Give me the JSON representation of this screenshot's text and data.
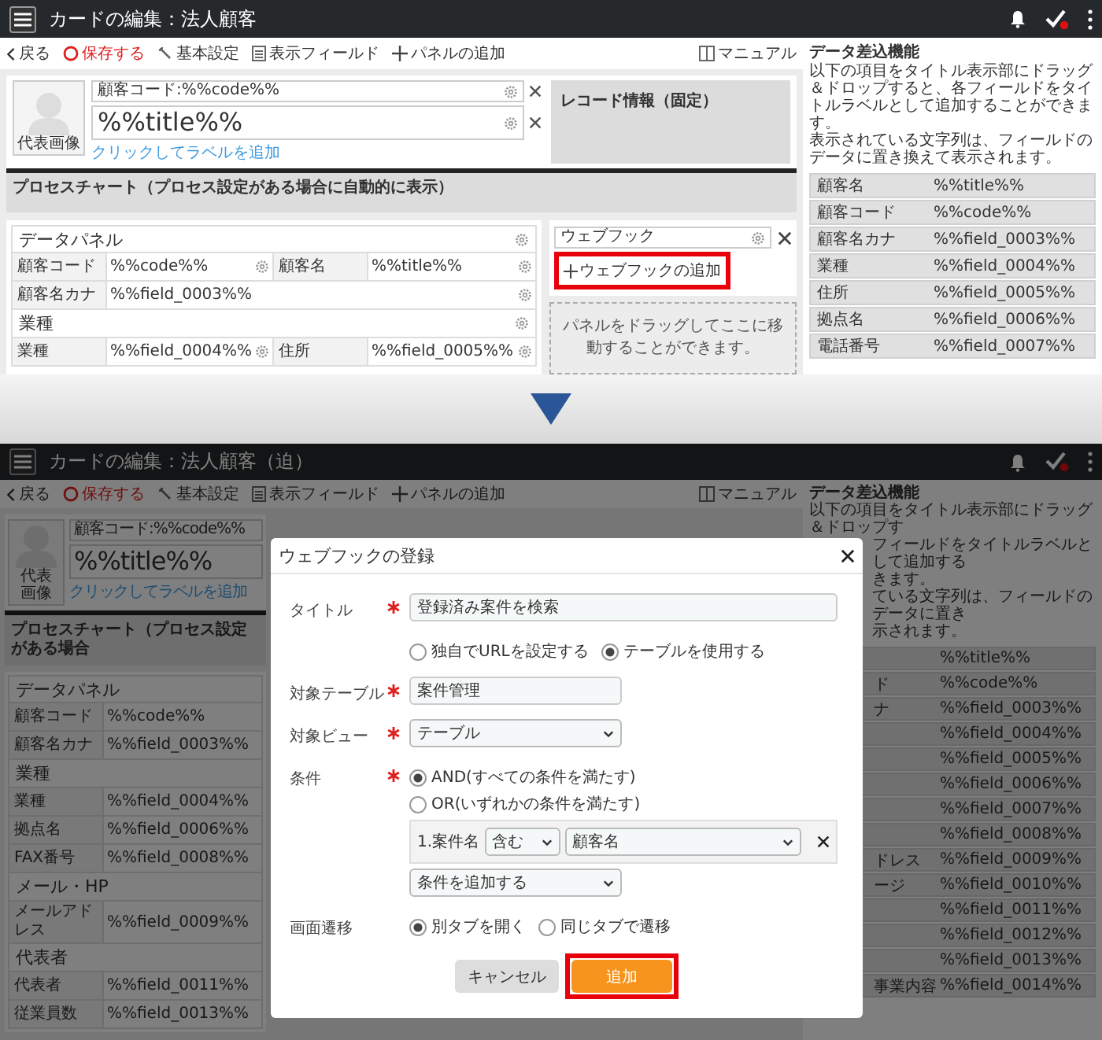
{
  "top_screen": {
    "header": {
      "title": "カードの編集：法人顧客"
    },
    "toolbar": [
      {
        "kind": "back",
        "label": "戻る"
      },
      {
        "kind": "save",
        "label": "保存する"
      },
      {
        "kind": "settings",
        "label": "基本設定"
      },
      {
        "kind": "fields",
        "label": "表示フィールド"
      },
      {
        "kind": "add",
        "label": "パネルの追加"
      }
    ],
    "manual": "マニュアル",
    "card": {
      "avatar_label": "代表画像",
      "code_label": "顧客コード:%%code%%",
      "title_label": "%%title%%",
      "add_label_link": "クリックしてラベルを追加"
    },
    "record_info": "レコード情報（固定）",
    "process_chart": "プロセスチャート（プロセス設定がある場合に自動的に表示）",
    "data_panel": {
      "title": "データパネル",
      "rows": [
        {
          "kind": "fields",
          "cells": [
            {
              "label": "顧客コード",
              "value": "%%code%%"
            },
            {
              "label": "顧客名",
              "value": "%%title%%"
            }
          ]
        },
        {
          "kind": "fields",
          "cells": [
            {
              "label": "顧客名カナ",
              "value": "%%field_0003%%"
            }
          ]
        },
        {
          "kind": "section",
          "label": "業種"
        },
        {
          "kind": "fields",
          "cells": [
            {
              "label": "業種",
              "value": "%%field_0004%%"
            },
            {
              "label": "住所",
              "value": "%%field_0005%%"
            }
          ]
        }
      ]
    },
    "webhook_panel": {
      "field": "ウェブフック",
      "add_link": {
        "label": "ウェブフックの追加",
        "highlighted": true
      }
    },
    "drop_zone": "パネルをドラッグしてここに移動することができます。",
    "side_panel": {
      "title": "データ差込機能",
      "description": [
        "以下の項目をタイトル表示部にドラッグ＆ドロップすると、各フィールドをタイトルラベルとして追加することができます。",
        "表示されている文字列は、フィールドのデータに置き換えて表示されます。"
      ],
      "rows": [
        {
          "label": "顧客名",
          "value": "%%title%%"
        },
        {
          "label": "顧客コード",
          "value": "%%code%%"
        },
        {
          "label": "顧客名カナ",
          "value": "%%field_0003%%"
        },
        {
          "label": "業種",
          "value": "%%field_0004%%"
        },
        {
          "label": "住所",
          "value": "%%field_0005%%"
        },
        {
          "label": "拠点名",
          "value": "%%field_0006%%"
        },
        {
          "label": "電話番号",
          "value": "%%field_0007%%"
        }
      ]
    }
  },
  "bottom_screen": {
    "header": {
      "title": "カードの編集：法人顧客（迫）"
    },
    "toolbar": [
      {
        "kind": "back",
        "label": "戻る"
      },
      {
        "kind": "save",
        "label": "保存する"
      },
      {
        "kind": "settings",
        "label": "基本設定"
      },
      {
        "kind": "fields",
        "label": "表示フィールド"
      },
      {
        "kind": "add",
        "label": "パネルの追加"
      }
    ],
    "manual": "マニュアル",
    "card": {
      "avatar_label": "代表画像",
      "code_label": "顧客コード:%%code%%",
      "title_label": "%%title%%",
      "add_label_link": "クリックしてラベルを追加"
    },
    "process_chart": "プロセスチャート（プロセス設定がある場合",
    "data_panel": {
      "title": "データパネル",
      "rows": [
        {
          "kind": "fields",
          "cells": [
            {
              "label": "顧客コード",
              "value": "%%code%%"
            }
          ]
        },
        {
          "kind": "fields",
          "cells": [
            {
              "label": "顧客名カナ",
              "value": "%%field_0003%%"
            }
          ]
        },
        {
          "kind": "section",
          "label": "業種"
        },
        {
          "kind": "fields",
          "cells": [
            {
              "label": "業種",
              "value": "%%field_0004%%"
            }
          ]
        },
        {
          "kind": "fields",
          "cells": [
            {
              "label": "拠点名",
              "value": "%%field_0006%%"
            }
          ]
        },
        {
          "kind": "fields",
          "cells": [
            {
              "label": "FAX番号",
              "value": "%%field_0008%%"
            }
          ]
        },
        {
          "kind": "section",
          "label": "メール・HP"
        },
        {
          "kind": "fields",
          "cells": [
            {
              "label": "メールアドレス",
              "value": "%%field_0009%%"
            }
          ]
        },
        {
          "kind": "section",
          "label": "代表者"
        },
        {
          "kind": "fields",
          "cells": [
            {
              "label": "代表者",
              "value": "%%field_0011%%"
            }
          ]
        },
        {
          "kind": "fields",
          "cells": [
            {
              "label": "従業員数",
              "value": "%%field_0013%%"
            }
          ]
        }
      ]
    },
    "side_panel": {
      "title": "データ差込機能",
      "description": [
        "以下の項目をタイトル表示部にドラッグ＆ドロップす",
        "フィールドをタイトルラベルとして追加する",
        "きます。",
        "ている文字列は、フィールドのデータに置き",
        "示されます。"
      ],
      "rows": [
        {
          "value": "%%title%%"
        },
        {
          "label": "ド",
          "value": "%%code%%"
        },
        {
          "label": "ナ",
          "value": "%%field_0003%%"
        },
        {
          "value": "%%field_0004%%"
        },
        {
          "value": "%%field_0005%%"
        },
        {
          "value": "%%field_0006%%"
        },
        {
          "value": "%%field_0007%%"
        },
        {
          "value": "%%field_0008%%"
        },
        {
          "label": "ドレス",
          "value": "%%field_0009%%"
        },
        {
          "label": "ージ",
          "value": "%%field_0010%%"
        },
        {
          "value": "%%field_0011%%"
        },
        {
          "value": "%%field_0012%%"
        },
        {
          "value": "%%field_0013%%"
        },
        {
          "label": "事業内容",
          "value": "%%field_0014%%"
        }
      ]
    },
    "dialog": {
      "title": "ウェブフックの登録",
      "fields": [
        {
          "kind": "text",
          "label": "タイトル",
          "required": true,
          "value": "登録済み案件を検索"
        },
        {
          "kind": "radios",
          "options": [
            {
              "label": "独自でURLを設定する",
              "selected": false
            },
            {
              "label": "テーブルを使用する",
              "selected": true
            }
          ]
        },
        {
          "kind": "text",
          "label": "対象テーブル",
          "required": true,
          "value": "案件管理"
        },
        {
          "kind": "select",
          "label": "対象ビュー",
          "required": true,
          "value": "テーブル"
        },
        {
          "kind": "condition",
          "label": "条件",
          "required": true,
          "options": [
            {
              "label": "AND(すべての条件を満たす)",
              "selected": true
            },
            {
              "label": "OR(いずれかの条件を満たす)",
              "selected": false
            }
          ],
          "rules": [
            {
              "field": "1.案件名",
              "operator": "含む",
              "value": "顧客名"
            }
          ],
          "add_select": "条件を追加する"
        },
        {
          "kind": "radios",
          "label": "画面遷移",
          "options": [
            {
              "label": "別タブを開く",
              "selected": true
            },
            {
              "label": "同じタブで遷移",
              "selected": false
            }
          ]
        }
      ],
      "buttons": [
        {
          "kind": "cancel",
          "label": "キャンセル",
          "highlighted": false
        },
        {
          "kind": "primary",
          "label": "追加",
          "highlighted": true
        }
      ]
    }
  }
}
